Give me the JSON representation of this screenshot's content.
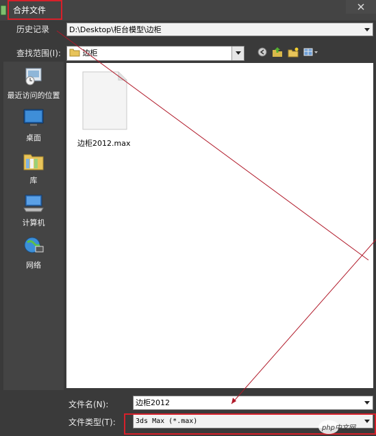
{
  "window": {
    "title": "合并文件"
  },
  "history": {
    "label": "历史记录",
    "path": "D:\\Desktop\\柜台模型\\边柜"
  },
  "look_in": {
    "label": "查找范围(I):",
    "folder": "边柜"
  },
  "sidebar": {
    "items": [
      {
        "label": "最近访问的位置",
        "icon": "recent-places-icon"
      },
      {
        "label": "桌面",
        "icon": "desktop-icon"
      },
      {
        "label": "库",
        "icon": "library-icon"
      },
      {
        "label": "计算机",
        "icon": "computer-icon"
      },
      {
        "label": "网络",
        "icon": "network-icon"
      }
    ]
  },
  "files": [
    {
      "name": "边柜2012.max",
      "icon": "blank-document-icon"
    }
  ],
  "filename": {
    "label": "文件名(N):",
    "value": "边柜2012"
  },
  "filetype": {
    "label": "文件类型(T):",
    "value": "3ds Max (*.max)"
  },
  "watermark": {
    "text": "php中文网"
  },
  "colors": {
    "highlight": "#d8202a",
    "annotation_line": "#b01828"
  }
}
